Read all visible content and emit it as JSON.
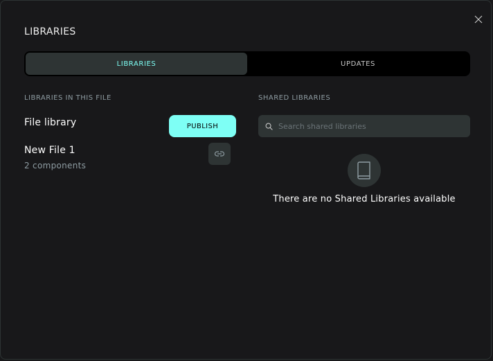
{
  "dialog": {
    "title": "LIBRARIES"
  },
  "tabs": [
    {
      "label": "LIBRARIES",
      "active": true
    },
    {
      "label": "UPDATES",
      "active": false
    }
  ],
  "local": {
    "section_label": "LIBRARIES IN THIS FILE",
    "file_library_label": "File library",
    "publish_label": "PUBLISH",
    "libraries": [
      {
        "name": "New File 1",
        "components": "2 components"
      }
    ]
  },
  "shared": {
    "section_label": "SHARED LIBRARIES",
    "search_placeholder": "Search shared libraries",
    "search_value": "",
    "empty_text": "There are no Shared Libraries available"
  },
  "colors": {
    "background": "#18181a",
    "surface": "#2e3434",
    "accent": "#7efff5",
    "muted_text": "#8f9da3"
  },
  "icons": {
    "close": "close-icon",
    "search": "search-icon",
    "unlink": "unlink-icon",
    "empty": "book-icon"
  }
}
